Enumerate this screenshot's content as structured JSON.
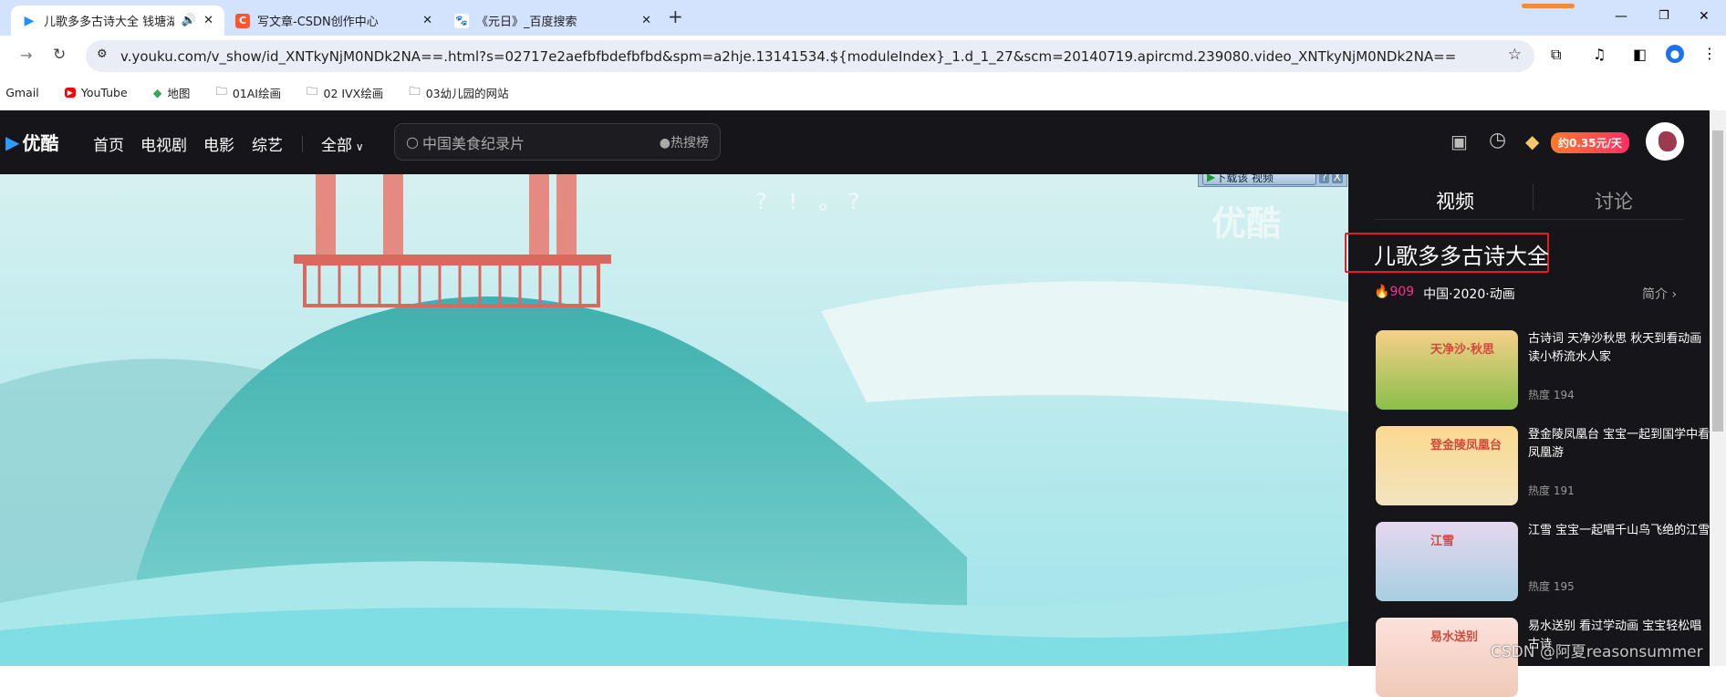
{
  "browser": {
    "tabs": [
      {
        "title": "儿歌多多古诗大全 钱塘湖春",
        "icon": "youku-icon",
        "active": true,
        "audio": true
      },
      {
        "title": "写文章-CSDN创作中心",
        "icon": "csdn-icon"
      },
      {
        "title": "《元日》_百度搜索",
        "icon": "baidu-icon"
      }
    ],
    "new_tab": "+",
    "url": "v.youku.com/v_show/id_XNTkyNjM0NDk2NA==.html?s=02717e2aefbfbdefbfbd&spm=a2hje.13141534.${moduleIndex}_1.d_1_27&scm=20140719.apircmd.239080.video_XNTkyNjM0NDk2NA==",
    "bookmarks": [
      {
        "label": "Gmail",
        "icon": "gmail-icon"
      },
      {
        "label": "YouTube",
        "icon": "youtube-icon"
      },
      {
        "label": "地图",
        "icon": "maps-icon"
      },
      {
        "label": "01AI绘画",
        "icon": "folder-icon"
      },
      {
        "label": "02 IVX绘画",
        "icon": "folder-icon"
      },
      {
        "label": "03幼儿园的网站",
        "icon": "folder-icon"
      }
    ]
  },
  "header": {
    "logo": "优酷",
    "nav": [
      "首页",
      "电视剧",
      "电影",
      "综艺"
    ],
    "all": "全部",
    "search_placeholder": "中国美食纪录片",
    "hot": "热搜榜",
    "vip_price": "约0.35元/天"
  },
  "player": {
    "download_label": "下载该 视频",
    "watermark": "优酷",
    "caption": "? ! 。?"
  },
  "side": {
    "tabs": [
      "视频",
      "讨论"
    ],
    "title": "儿歌多多古诗大全",
    "heat": "909",
    "meta": "中国·2020·动画",
    "intro": "简介",
    "items": [
      {
        "title": "古诗词 天净沙秋思 秋天到看动画读小桥流水人家",
        "heat": "热度 194",
        "thumb_text": "天净沙·秋思",
        "colors": [
          "#f7d08a",
          "#8bbf4a"
        ]
      },
      {
        "title": "登金陵凤凰台 宝宝一起到国学中看凤凰游",
        "heat": "热度 191",
        "thumb_text": "登金陵凤凰台",
        "colors": [
          "#fbd98f",
          "#f3e3c0"
        ]
      },
      {
        "title": "江雪 宝宝一起唱千山鸟飞绝的江雪",
        "heat": "热度 195",
        "thumb_text": "江雪",
        "colors": [
          "#e6d7f0",
          "#a8cfe0"
        ]
      },
      {
        "title": "易水送别 看过学动画 宝宝轻松唱古诗",
        "heat": "",
        "thumb_text": "易水送别",
        "colors": [
          "#fbe2dc",
          "#f0c9b8"
        ]
      }
    ]
  },
  "watermark": "CSDN @阿夏reasonsummer",
  "colors": {
    "accent": "#ff2e63",
    "highlight_box": "#e02020"
  }
}
